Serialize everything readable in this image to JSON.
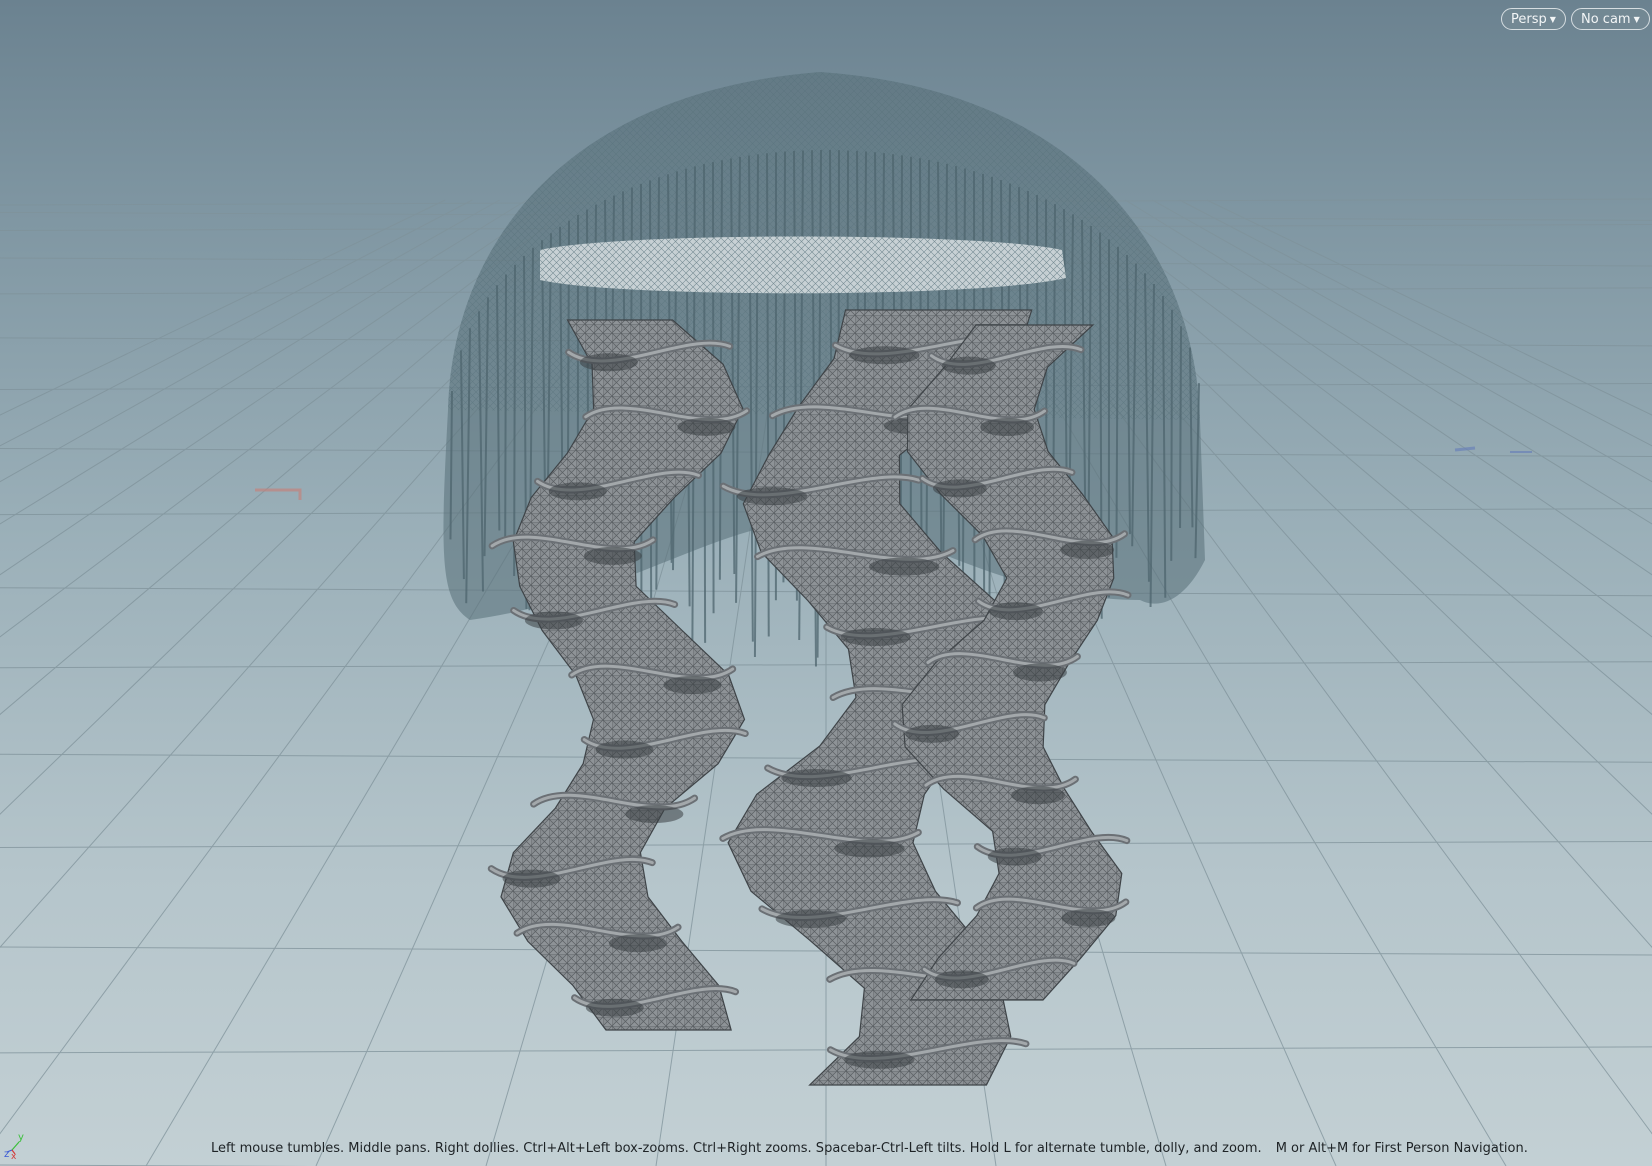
{
  "viewport": {
    "camera_view": "Persp",
    "camera": "No cam",
    "status_text": "Left mouse tumbles. Middle pans. Right dollies. Ctrl+Alt+Left box-zooms. Ctrl+Right zooms. Spacebar-Ctrl-Left tilts. Hold L for alternate tumble, dolly, and zoom.",
    "status_text_nav": "M or Alt+M for First Person Navigation.",
    "axis_labels": {
      "y": "y",
      "z": "z",
      "x": "x"
    },
    "icons": [
      "chevron-down-icon",
      "axis-gizmo-icon"
    ],
    "colors": {
      "background_top": "#6b8290",
      "background_bottom": "#c3d0d4",
      "wireframe": "#4e636c",
      "mesh_fill": "#8d9296",
      "axis_x": "#d43a3a",
      "axis_y": "#3bbf3b",
      "axis_z": "#3a5bd4"
    }
  }
}
